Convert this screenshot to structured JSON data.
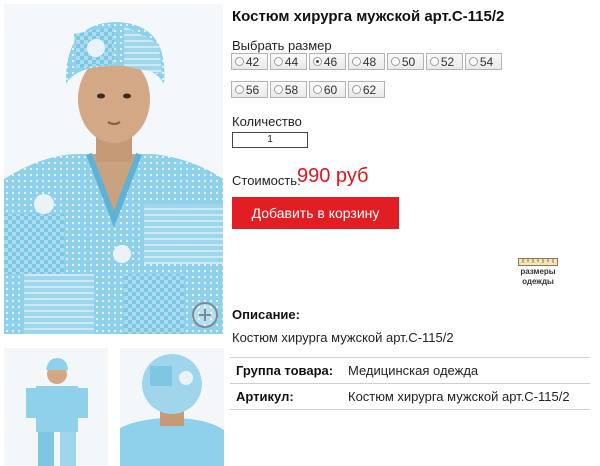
{
  "product": {
    "title": "Костюм хирурга мужской арт.С-115/2"
  },
  "size_selector": {
    "label": "Выбрать размер",
    "options": [
      "42",
      "44",
      "46",
      "48",
      "50",
      "52",
      "54",
      "56",
      "58",
      "60",
      "62"
    ],
    "selected": "46"
  },
  "quantity": {
    "label": "Количество",
    "value": "1"
  },
  "price": {
    "label": "Стоимость:",
    "value": "990 руб",
    "color": "#e0151b"
  },
  "cart": {
    "add_label": "Добавить в корзину",
    "button_color": "#e21e25"
  },
  "sizes_link": {
    "line1": "размеры",
    "line2": "одежды"
  },
  "description": {
    "label": "Описание:",
    "text": "Костюм хирурга мужской арт.С-115/2"
  },
  "properties": [
    {
      "key": "Группа товара:",
      "value": "Медицинская одежда"
    },
    {
      "key": "Артикул:",
      "value": "Костюм хирурга мужской арт.С-115/2"
    }
  ],
  "icons": {
    "zoom": "zoom-in-icon",
    "sizes": "ruler-icon"
  }
}
